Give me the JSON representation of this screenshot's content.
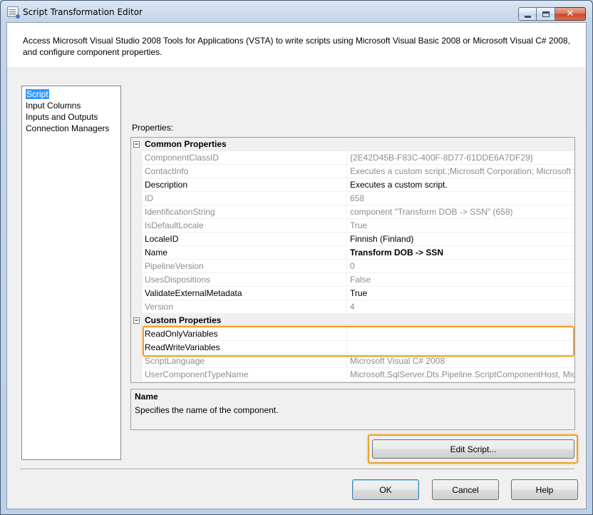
{
  "window": {
    "title": "Script Transformation Editor",
    "close_glyph": "✕"
  },
  "header": {
    "description": "Access Microsoft Visual Studio 2008 Tools for Applications (VSTA) to write scripts using Microsoft Visual Basic 2008 or Microsoft Visual C# 2008, and configure component properties."
  },
  "nav": {
    "items": [
      {
        "label": "Script",
        "selected": true
      },
      {
        "label": "Input Columns"
      },
      {
        "label": "Inputs and Outputs"
      },
      {
        "label": "Connection Managers"
      }
    ]
  },
  "properties": {
    "label": "Properties:",
    "categories": [
      {
        "name": "Common Properties",
        "toggle": "−",
        "rows": [
          {
            "name": "ComponentClassID",
            "value": "{2E42D45B-F83C-400F-8D77-61DDE6A7DF29}",
            "readonly": true
          },
          {
            "name": "ContactInfo",
            "value": "Executes a custom script.;Microsoft Corporation; Microsoft S",
            "readonly": true
          },
          {
            "name": "Description",
            "value": "Executes a custom script.",
            "readonly": false
          },
          {
            "name": "ID",
            "value": "658",
            "readonly": true
          },
          {
            "name": "IdentificationString",
            "value": "component \"Transform DOB -> SSN\" (658)",
            "readonly": true
          },
          {
            "name": "IsDefaultLocale",
            "value": "True",
            "readonly": true
          },
          {
            "name": "LocaleID",
            "value": "Finnish (Finland)",
            "readonly": false
          },
          {
            "name": "Name",
            "value": "Transform DOB -> SSN",
            "readonly": false,
            "bold": true
          },
          {
            "name": "PipelineVersion",
            "value": "0",
            "readonly": true
          },
          {
            "name": "UsesDispositions",
            "value": "False",
            "readonly": true
          },
          {
            "name": "ValidateExternalMetadata",
            "value": "True",
            "readonly": false
          },
          {
            "name": "Version",
            "value": "4",
            "readonly": true
          }
        ]
      },
      {
        "name": "Custom Properties",
        "toggle": "−",
        "rows": [
          {
            "name": "ReadOnlyVariables",
            "value": "",
            "readonly": false
          },
          {
            "name": "ReadWriteVariables",
            "value": "",
            "readonly": false
          },
          {
            "name": "ScriptLanguage",
            "value": "Microsoft Visual C# 2008",
            "readonly": true
          },
          {
            "name": "UserComponentTypeName",
            "value": "Microsoft.SqlServer.Dts.Pipeline.ScriptComponentHost, Mic",
            "readonly": true
          }
        ]
      }
    ]
  },
  "help": {
    "title": "Name",
    "text": "Specifies the name of the component."
  },
  "buttons": {
    "edit_script": "Edit Script...",
    "ok": "OK",
    "cancel": "Cancel",
    "help": "Help"
  },
  "colors": {
    "selection": "#3399ff",
    "highlight_outline": "#f0a02c",
    "readonly_text": "#8d8d8d"
  }
}
